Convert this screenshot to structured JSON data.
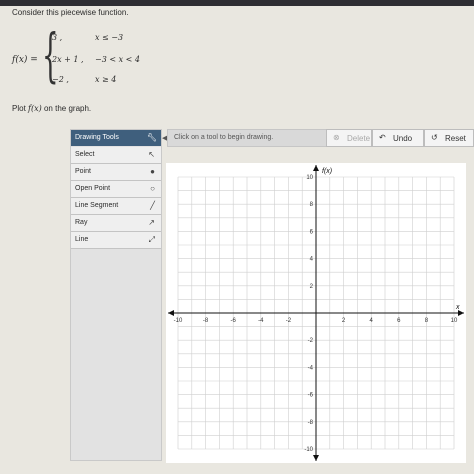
{
  "question": "Consider this piecewise function.",
  "function_label": "f(x) =",
  "cases": [
    {
      "value": "3 ,",
      "condition": "x ≤ −3"
    },
    {
      "value": "2x + 1 ,",
      "condition": "−3 < x < 4"
    },
    {
      "value": "−2 ,",
      "condition": "x ≥ 4"
    }
  ],
  "instruction_prefix": "Plot",
  "instruction_math": "f(x)",
  "instruction_suffix": "on the graph.",
  "drawing_tools": {
    "title": "Drawing Tools",
    "items": [
      {
        "label": "Select",
        "icon": "pointer-icon"
      },
      {
        "label": "Point",
        "icon": "dot-icon"
      },
      {
        "label": "Open Point",
        "icon": "open-dot-icon"
      },
      {
        "label": "Line Segment",
        "icon": "segment-icon"
      },
      {
        "label": "Ray",
        "icon": "ray-icon"
      },
      {
        "label": "Line",
        "icon": "line-icon"
      }
    ]
  },
  "toolbar": {
    "hint": "Click on a tool to begin drawing.",
    "delete_label": "Delete",
    "undo_label": "Undo",
    "reset_label": "Reset"
  },
  "graph": {
    "y_axis_label": "f(x)",
    "x_axis_label": "x",
    "x_range": [
      -10,
      10
    ],
    "y_range": [
      -10,
      10
    ],
    "grid": true,
    "tick_labels": [
      "-10",
      "-8",
      "-6",
      "-4",
      "-2",
      "2",
      "4",
      "6",
      "8",
      "10"
    ]
  },
  "colors": {
    "panel_header": "#3f5f7d",
    "grid_line": "#cfcfcf",
    "axis": "#111111"
  }
}
